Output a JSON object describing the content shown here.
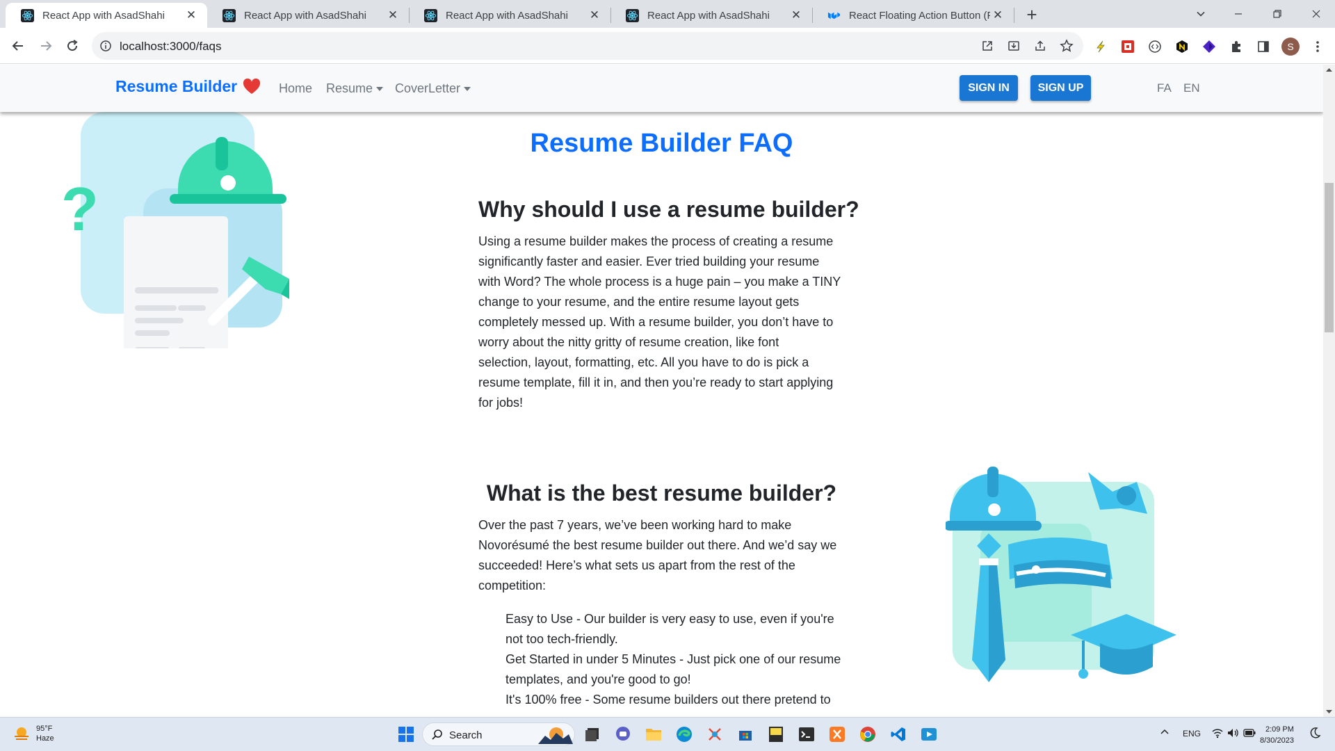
{
  "browser": {
    "tabs": [
      {
        "title": "React App with AsadShahi",
        "active": true,
        "icon": "react-icon"
      },
      {
        "title": "React App with AsadShahi",
        "active": false,
        "icon": "react-icon"
      },
      {
        "title": "React App with AsadShahi",
        "active": false,
        "icon": "react-icon"
      },
      {
        "title": "React App with AsadShahi",
        "active": false,
        "icon": "react-icon"
      },
      {
        "title": "React Floating Action Button (FAB",
        "active": false,
        "icon": "mui-icon"
      }
    ],
    "url": "localhost:3000/faqs",
    "profile_initial": "S"
  },
  "navbar": {
    "brand": "Resume Builder",
    "links": [
      "Home",
      "Resume",
      "CoverLetter"
    ],
    "sign_in": "SIGN IN",
    "sign_up": "SIGN UP",
    "languages": [
      "FA",
      "EN"
    ]
  },
  "faq": {
    "heading": "Resume Builder FAQ",
    "items": [
      {
        "question": "Why should I use a resume builder?",
        "answer_lines": [
          "Using a resume builder makes the process of creating a resume",
          "significantly faster and easier. Ever tried building your resume",
          "with Word? The whole process is a huge pain – you make a TINY",
          "change to your resume, and the entire resume layout gets",
          "completely messed up. With a resume builder, you don’t have to",
          "worry about the nitty gritty of resume creation, like font",
          "selection, layout, formatting, etc. All you have to do is pick a",
          "resume template, fill it in, and then you’re ready to start applying",
          "for jobs!"
        ]
      },
      {
        "question": "What is the best resume builder?",
        "answer_lines": [
          "Over the past 7 years, we’ve been working hard to make",
          "Novorésumé the best resume builder out there. And we’d say we",
          "succeeded! Here’s what sets us apart from the rest of the",
          "competition:"
        ],
        "features": [
          [
            "Easy to Use - Our builder is very easy to use, even if you're",
            "not too tech-friendly."
          ],
          [
            "Get Started in under 5 Minutes - Just pick one of our resume",
            "templates, and you're good to go!"
          ],
          [
            "It's 100% free - Some resume builders out there pretend to"
          ]
        ]
      }
    ]
  },
  "taskbar": {
    "weather_temp": "95°F",
    "weather_desc": "Haze",
    "search_label": "Search",
    "language": "ENG",
    "time": "2:09 PM",
    "date": "8/30/2023"
  },
  "colors": {
    "brand_blue": "#0d6efd",
    "button_blue": "#1976d2",
    "heart_red": "#e53935",
    "illustration_mint": "#3ddbb0",
    "illustration_sky": "#3ec1ec"
  }
}
